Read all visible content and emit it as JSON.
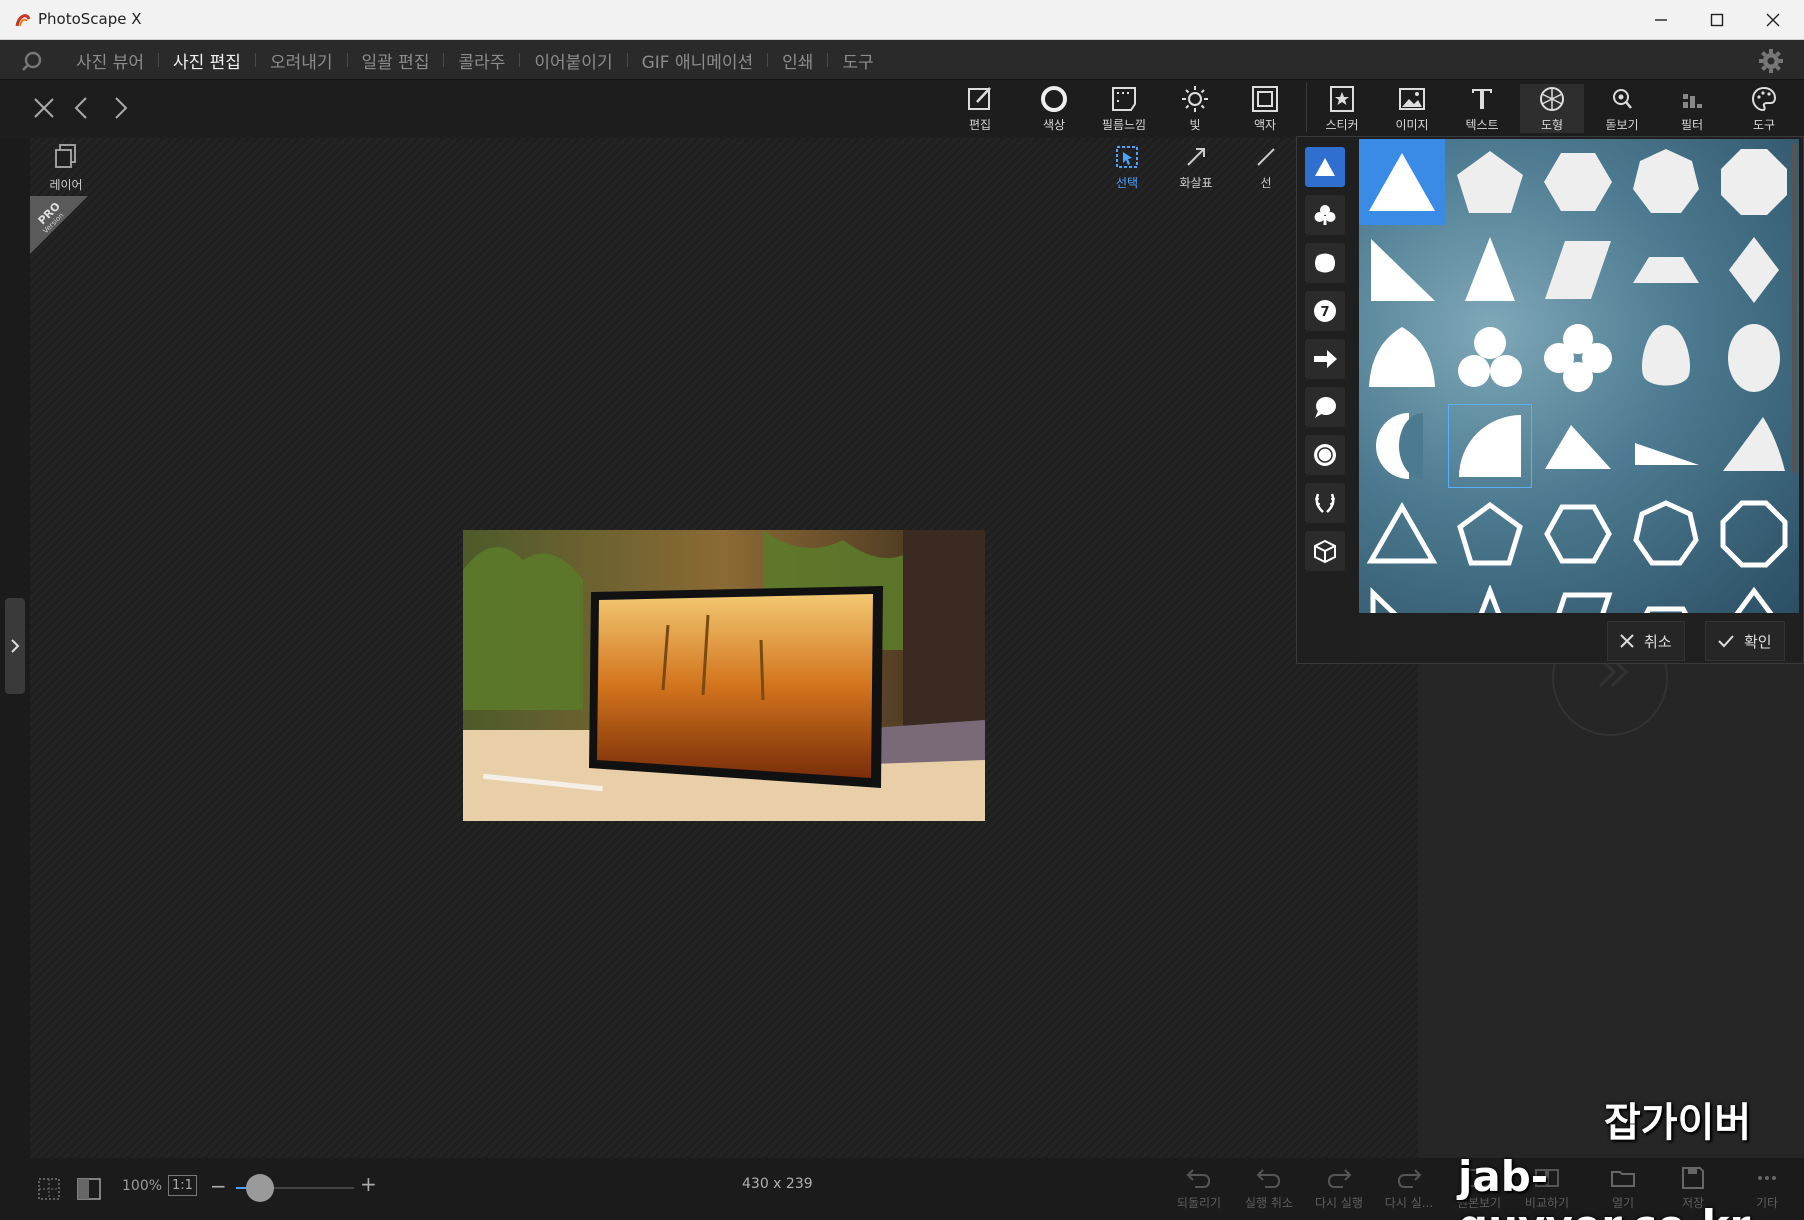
{
  "window": {
    "title": "PhotoScape X"
  },
  "menu": {
    "items": [
      "사진 뷰어",
      "사진 편집",
      "오려내기",
      "일괄 편집",
      "콜라주",
      "이어붙이기",
      "GIF 애니메이션",
      "인쇄",
      "도구"
    ],
    "active": "사진 편집"
  },
  "toolbar": {
    "tools": [
      "편집",
      "색상",
      "필름느낌",
      "빛",
      "액자",
      "스티커",
      "이미지",
      "텍스트",
      "도형",
      "돋보기",
      "필터",
      "도구"
    ]
  },
  "layer_label": "레이어",
  "pro_badge": {
    "line1": "PRO",
    "line2": "Version"
  },
  "subtools": [
    "선택",
    "화살표",
    "선"
  ],
  "popup": {
    "cancel_label": "취소",
    "confirm_label": "확인",
    "categories": [
      "triangle-icon",
      "club-icon",
      "badge-icon",
      "number-icon",
      "arrow-icon",
      "speech-bubble-icon",
      "seal-icon",
      "laurel-icon",
      "cube-icon"
    ]
  },
  "statusbar": {
    "zoom": "100%",
    "ratio_label": "1:1",
    "minus": "−",
    "plus": "+",
    "dimensions": "430 x 239",
    "zoom_level": 0.1
  },
  "bottom_actions": [
    "되돌리기",
    "실행 취소",
    "다시 실행",
    "다시 실...",
    "원본보기",
    "비교하기",
    "열기",
    "저장",
    "기타"
  ],
  "watermark": {
    "name": "잡가이버",
    "url": "jab-guyver.co.kr"
  },
  "colors": {
    "accent": "#3a8be6",
    "background": "#1b1b1b"
  }
}
